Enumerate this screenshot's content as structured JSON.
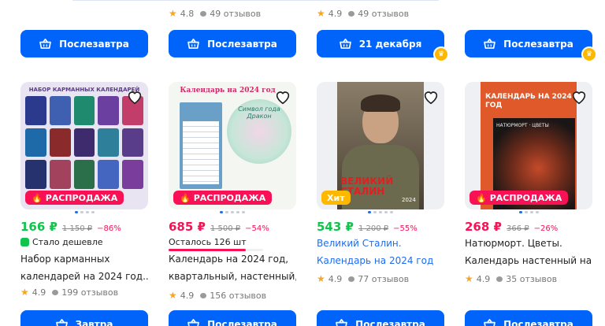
{
  "top_row": [
    {
      "rating": "",
      "reviews": ""
    },
    {
      "rating": "4.8",
      "reviews": "49 отзывов"
    },
    {
      "rating": "4.9",
      "reviews": "49 отзывов"
    },
    {
      "rating": "",
      "reviews": ""
    }
  ],
  "top_buttons": [
    "Послезавтра",
    "Послезавтра",
    "21 декабря",
    "Послезавтра"
  ],
  "products": [
    {
      "image_text": "НАБОР КАРМАННЫХ КАЛЕНДАРЕЙ",
      "badge": "РАСПРОДАЖА",
      "price": "166 ₽",
      "old_price": "1 150 ₽",
      "discount": "−86%",
      "note": "Стало дешевле",
      "title_lines": [
        "Набор карманных",
        "календарей на 2024 год..."
      ],
      "rating": "4.9",
      "reviews": "199 отзывов",
      "button": "Завтра"
    },
    {
      "image_text": "Календарь на 2024 год",
      "image_sub": "Символ года Дракон",
      "badge": "РАСПРОДАЖА",
      "price": "685 ₽",
      "old_price": "1 500 ₽",
      "discount": "−54%",
      "note": "Осталось 126 шт",
      "stock_fraction": 0.82,
      "title_lines": [
        "Календарь на 2024 год,",
        "квартальный, настенный,..."
      ],
      "rating": "4.9",
      "reviews": "156 отзывов",
      "button": "Послезавтра"
    },
    {
      "image_text": "ВЕЛИКИЙ СТАЛИН",
      "image_year": "2024",
      "badge": "Хит",
      "price": "543 ₽",
      "old_price": "1 200 ₽",
      "discount": "−55%",
      "title_lines": [
        "Великий Сталин.",
        "Календарь на 2024 год"
      ],
      "rating": "4.9",
      "reviews": "77 отзывов",
      "button": "Послезавтра"
    },
    {
      "image_text": "КАЛЕНДАРЬ НА 2024 ГОД",
      "image_sub": "НАТЮРМОРТ · ЦВЕТЫ",
      "badge": "РАСПРОДАЖА",
      "price": "268 ₽",
      "old_price": "366 ₽",
      "discount": "−26%",
      "title_lines": [
        "Натюрморт. Цветы.",
        "Календарь настенный на..."
      ],
      "rating": "4.9",
      "reviews": "35 отзывов",
      "button": "Послезавтра"
    }
  ],
  "colors": {
    "accent": "#0064fa",
    "sale": "#f91155",
    "green_price": "#10c44c",
    "hit": "#ffb800"
  },
  "icons": {
    "cart": "basket-icon",
    "heart": "heart-icon",
    "fire": "fire-icon",
    "star": "star-icon",
    "review": "speech-bubble-icon"
  }
}
